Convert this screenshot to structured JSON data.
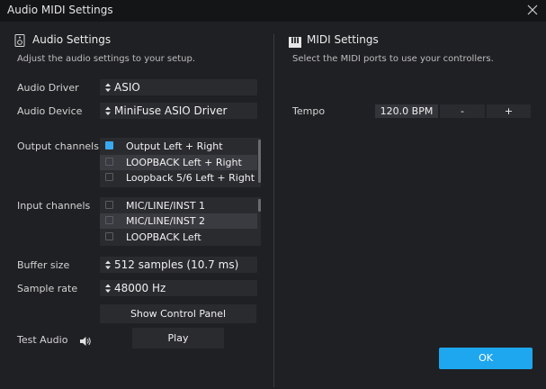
{
  "window": {
    "title": "Audio MIDI Settings"
  },
  "audio": {
    "heading": "Audio Settings",
    "subtitle": "Adjust the audio settings to your setup.",
    "driver": {
      "label": "Audio Driver",
      "value": "ASIO"
    },
    "device": {
      "label": "Audio Device",
      "value": "MiniFuse ASIO Driver"
    },
    "output": {
      "label": "Output channels",
      "items": [
        {
          "label": "Output Left + Right",
          "checked": true
        },
        {
          "label": "LOOPBACK Left + Right",
          "checked": false
        },
        {
          "label": "Loopback 5/6 Left + Right",
          "checked": false
        }
      ]
    },
    "input": {
      "label": "Input channels",
      "items": [
        {
          "label": "MIC/LINE/INST 1",
          "checked": false
        },
        {
          "label": "MIC/LINE/INST 2",
          "checked": false
        },
        {
          "label": "LOOPBACK Left",
          "checked": false
        }
      ]
    },
    "buffer": {
      "label": "Buffer size",
      "value": "512 samples (10.7 ms)"
    },
    "samplerate": {
      "label": "Sample rate",
      "value": "48000 Hz"
    },
    "control_panel_label": "Show Control Panel",
    "test": {
      "label": "Test Audio",
      "play_label": "Play"
    }
  },
  "midi": {
    "heading": "MIDI Settings",
    "subtitle": "Select the MIDI ports to use your controllers.",
    "tempo": {
      "label": "Tempo",
      "value": "120.0 BPM",
      "minus": "-",
      "plus": "+"
    }
  },
  "ok_label": "OK",
  "colors": {
    "accent": "#1ea7ee",
    "checkbox_on": "#3ba9f2",
    "background": "#1f2023",
    "field": "#2a2b2f"
  }
}
